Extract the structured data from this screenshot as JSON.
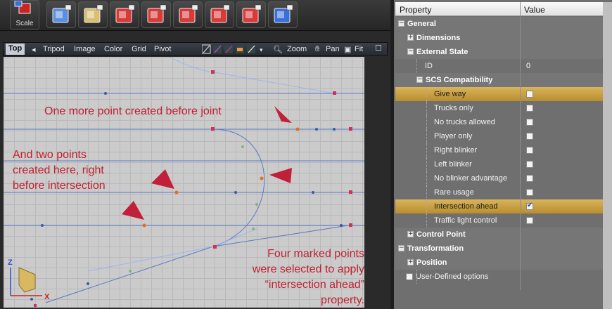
{
  "toolbar": {
    "scale_label": "Scale",
    "tools": [
      "box-icon",
      "brush-icon",
      "arrow-icon",
      "block-icon",
      "move-icon",
      "curve-icon",
      "diamond-icon",
      "grid-icon"
    ]
  },
  "viewport_toolbar": {
    "view": "Top",
    "menu": [
      "Tripod",
      "Image",
      "Color",
      "Grid",
      "Pivot"
    ],
    "zoom": "Zoom",
    "pan": "Pan",
    "fit": "Fit"
  },
  "viewport": {
    "annotation_1": "One more point created before joint",
    "annotation_2": "And two points\ncreated here, right\nbefore intersection",
    "annotation_3": "Four marked points\nwere selected to apply\n“intersection ahead” property.",
    "axis_z": "Z",
    "axis_x": "X"
  },
  "properties": {
    "header_property": "Property",
    "header_value": "Value",
    "rows": [
      {
        "label": "General",
        "kind": "category",
        "expander": "−",
        "indent": 0
      },
      {
        "label": "Dimensions",
        "kind": "category",
        "expander": "+",
        "indent": 1
      },
      {
        "label": "External State",
        "kind": "category",
        "expander": "−",
        "indent": 1
      },
      {
        "label": "ID",
        "kind": "item",
        "value": "0",
        "indent": 3
      },
      {
        "label": "SCS Compatibility",
        "kind": "category",
        "expander": "−",
        "indent": 2
      },
      {
        "label": "Give way",
        "kind": "check",
        "checked": false,
        "selected": true,
        "indent": 4
      },
      {
        "label": "Trucks only",
        "kind": "check",
        "checked": false,
        "indent": 4
      },
      {
        "label": "No trucks allowed",
        "kind": "check",
        "checked": false,
        "indent": 4
      },
      {
        "label": "Player only",
        "kind": "check",
        "checked": false,
        "indent": 4
      },
      {
        "label": "Right blinker",
        "kind": "check",
        "checked": false,
        "indent": 4
      },
      {
        "label": "Left blinker",
        "kind": "check",
        "checked": false,
        "indent": 4
      },
      {
        "label": "No blinker advantage",
        "kind": "check",
        "checked": false,
        "indent": 4
      },
      {
        "label": "Rare usage",
        "kind": "check",
        "checked": false,
        "indent": 4
      },
      {
        "label": "Intersection ahead",
        "kind": "check",
        "checked": true,
        "selected": true,
        "indent": 4
      },
      {
        "label": "Traffic light control",
        "kind": "check",
        "checked": false,
        "indent": 4
      },
      {
        "label": "Control Point",
        "kind": "category",
        "expander": "+",
        "indent": 1
      },
      {
        "label": "Transformation",
        "kind": "category",
        "expander": "−",
        "indent": 0
      },
      {
        "label": "Position",
        "kind": "category",
        "expander": "+",
        "indent": 1
      },
      {
        "label": "User-Defined options",
        "kind": "check-left",
        "checked": false,
        "indent": 1
      }
    ]
  }
}
